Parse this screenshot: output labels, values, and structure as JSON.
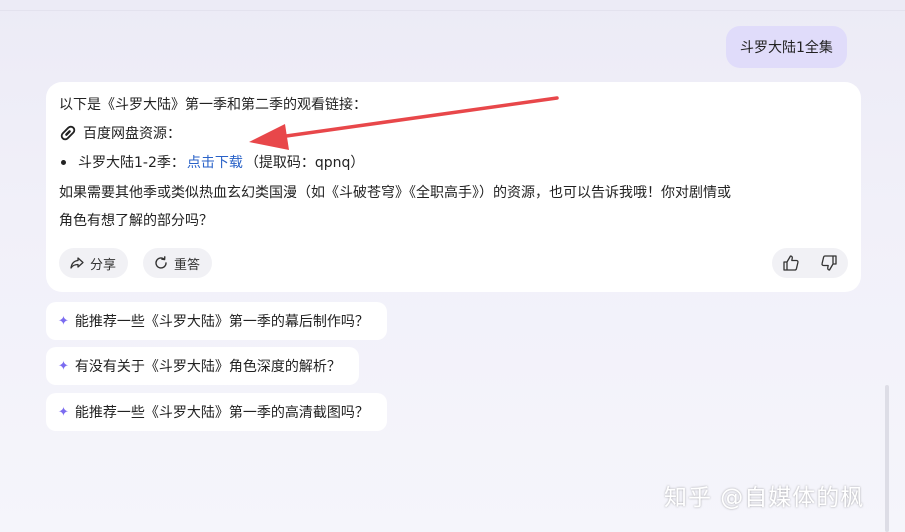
{
  "user_message": "斗罗大陆1全集",
  "answer": {
    "intro": "以下是《斗罗大陆》第一季和第二季的观看链接：",
    "source_label": "百度网盘资源：",
    "item_prefix": "斗罗大陆1-2季：",
    "item_link": "点击下载",
    "item_suffix": "（提取码：qpnq）",
    "outro_line1": "如果需要其他季或类似热血玄幻类国漫（如《斗破苍穹》《全职高手》）的资源，也可以告诉我哦！你对剧情或",
    "outro_line2": "角色有想了解的部分吗？"
  },
  "actions": {
    "share": "分享",
    "retry": "重答"
  },
  "suggestions": [
    "能推荐一些《斗罗大陆》第一季的幕后制作吗？",
    "有没有关于《斗罗大陆》角色深度的解析？",
    "能推荐一些《斗罗大陆》第一季的高清截图吗？"
  ],
  "watermark": "知乎 @自媒体的枫",
  "colors": {
    "accent_link": "#2962c8",
    "user_bubble": "#e0dcfa",
    "annotation_arrow": "#e8474a",
    "spark": "#7b6cf0"
  },
  "icons": [
    "paperclip-link-icon",
    "share-icon",
    "refresh-icon",
    "thumbs-up-icon",
    "thumbs-down-icon",
    "sparkle-icon"
  ]
}
